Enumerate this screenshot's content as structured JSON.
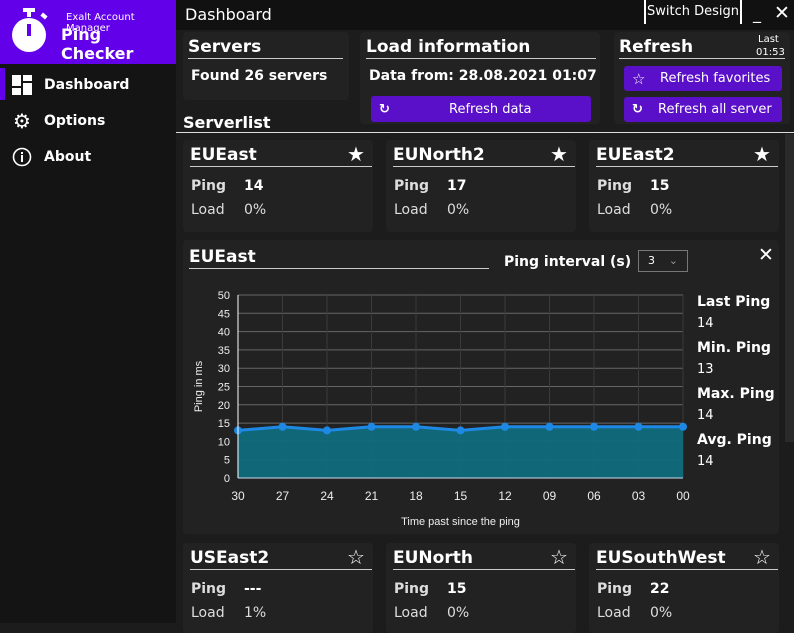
{
  "app": {
    "subtitle": "Exalt Account Manager",
    "title": "Ping Checker"
  },
  "sidebar": {
    "items": [
      {
        "label": "Dashboard",
        "icon": "dashboard-icon"
      },
      {
        "label": "Options",
        "icon": "gear-icon"
      },
      {
        "label": "About",
        "icon": "info-icon"
      }
    ]
  },
  "header": {
    "title": "Dashboard",
    "switch_design": "Switch Design"
  },
  "servers": {
    "title": "Servers",
    "text": "Found 26 servers"
  },
  "load": {
    "title": "Load information",
    "text": "Data from: 28.08.2021 01:07",
    "button": "Refresh data"
  },
  "refresh": {
    "title": "Refresh",
    "last_label": "Last",
    "last_time": "01:53",
    "fav_button": "Refresh favorites",
    "all_button": "Refresh all server"
  },
  "serverlist_title": "Serverlist",
  "labels": {
    "ping": "Ping",
    "load": "Load"
  },
  "top_cards": [
    {
      "name": "EUEast",
      "ping": "14",
      "load": "0%",
      "favorite": true
    },
    {
      "name": "EUNorth2",
      "ping": "17",
      "load": "0%",
      "favorite": true
    },
    {
      "name": "EUEast2",
      "ping": "15",
      "load": "0%",
      "favorite": true
    }
  ],
  "bottom_cards": [
    {
      "name": "USEast2",
      "ping": "---",
      "load": "1%",
      "favorite": false
    },
    {
      "name": "EUNorth",
      "ping": "15",
      "load": "0%",
      "favorite": false
    },
    {
      "name": "EUSouthWest",
      "ping": "22",
      "load": "0%",
      "favorite": false
    }
  ],
  "detail": {
    "title": "EUEast",
    "interval_label": "Ping interval (s)",
    "interval_value": "3",
    "stats": [
      {
        "label": "Last Ping",
        "value": "14"
      },
      {
        "label": "Min. Ping",
        "value": "13"
      },
      {
        "label": "Max. Ping",
        "value": "14"
      },
      {
        "label": "Avg. Ping",
        "value": "14"
      }
    ]
  },
  "chart_data": {
    "type": "area",
    "xlabel": "Time past since the ping",
    "ylabel": "Ping in ms",
    "ylim": [
      0,
      50
    ],
    "yticks": [
      0,
      5,
      10,
      15,
      20,
      25,
      30,
      35,
      40,
      45,
      50
    ],
    "categories": [
      "30",
      "27",
      "24",
      "21",
      "18",
      "15",
      "12",
      "09",
      "06",
      "03",
      "00"
    ],
    "values": [
      13,
      14,
      13,
      14,
      14,
      13,
      14,
      14,
      14,
      14,
      14
    ],
    "grid": true,
    "line_color": "#1e88e5",
    "fill_color": "#106b7c"
  }
}
